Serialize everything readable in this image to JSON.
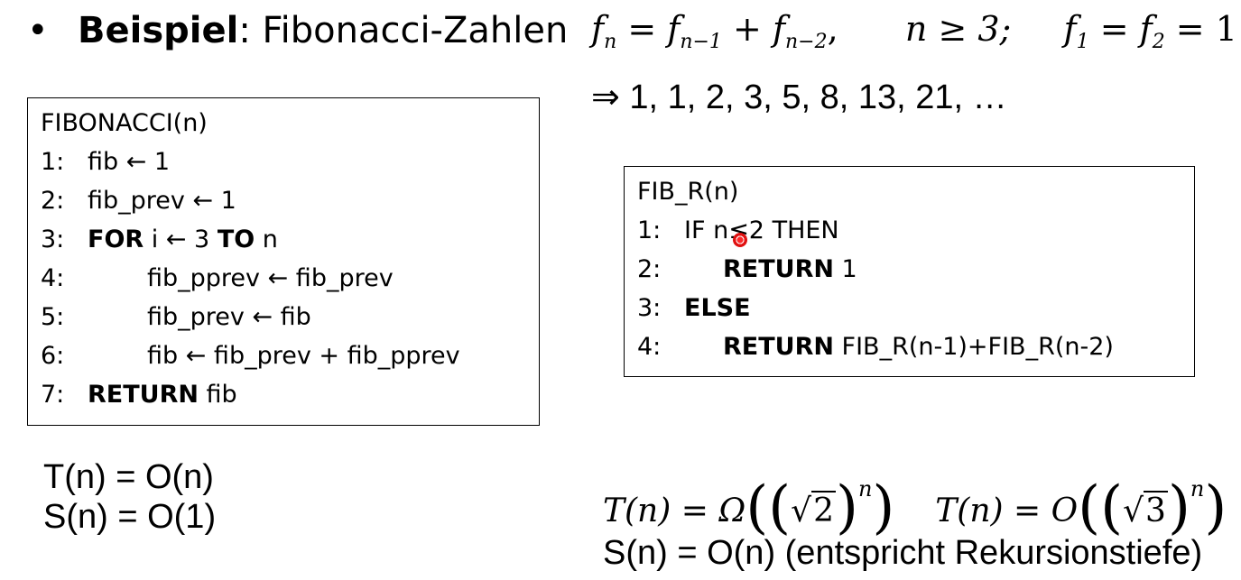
{
  "heading": {
    "bullet": "•",
    "bold": "Beispiel",
    "rest": ": Fibonacci-Zahlen"
  },
  "formula": {
    "f": "f",
    "n": "n",
    "nm1": "n−1",
    "nm2": "n−2",
    "eq": " = ",
    "plus": " + ",
    "comma": ",",
    "cond": "n ≥ 3;",
    "f1": "1",
    "f2": "2",
    "one": "1"
  },
  "sequence": "⇒ 1, 1, 2, 3, 5, 8, 13, 21, …",
  "iterative": {
    "lines": [
      {
        "num": "",
        "pre": "FIBONACCI(n)"
      },
      {
        "num": "1:",
        "pre": "fib ← 1"
      },
      {
        "num": "2:",
        "pre": "fib_prev ← 1"
      },
      {
        "num": "3:",
        "kw1": "FOR",
        "mid": " i ← 3 ",
        "kw2": "TO",
        "post": " n"
      },
      {
        "num": "4:",
        "pre": "fib_pprev ← fib_prev"
      },
      {
        "num": "5:",
        "pre": "fib_prev ← fib"
      },
      {
        "num": "6:",
        "pre": "fib ← fib_prev + fib_pprev"
      },
      {
        "num": "7:",
        "kw1": "RETURN",
        "post": " fib"
      }
    ]
  },
  "recursive": {
    "lines": [
      {
        "num": "",
        "pre": "FIB_R(n)"
      },
      {
        "num": "1:",
        "pre": "IF n≤2 THEN"
      },
      {
        "num": "2:",
        "kw1": "RETURN",
        "post": " 1"
      },
      {
        "num": "3:",
        "kw1": "ELSE"
      },
      {
        "num": "4:",
        "kw1": "RETURN",
        "post": "  FIB_R(n-1)+FIB_R(n-2)"
      }
    ]
  },
  "complexity_left": {
    "time": "T(n) = O(n)",
    "space": "S(n) = O(1)"
  },
  "complexity_right": {
    "t1": "T(n) = Ω",
    "r1": "2",
    "t2": "T(n) = O",
    "r2": "3",
    "exp": "n",
    "lparen": "(",
    "rparen": ")",
    "sqrt": "√",
    "space": "S(n) = O(n) (entspricht Rekursionstiefe)"
  }
}
